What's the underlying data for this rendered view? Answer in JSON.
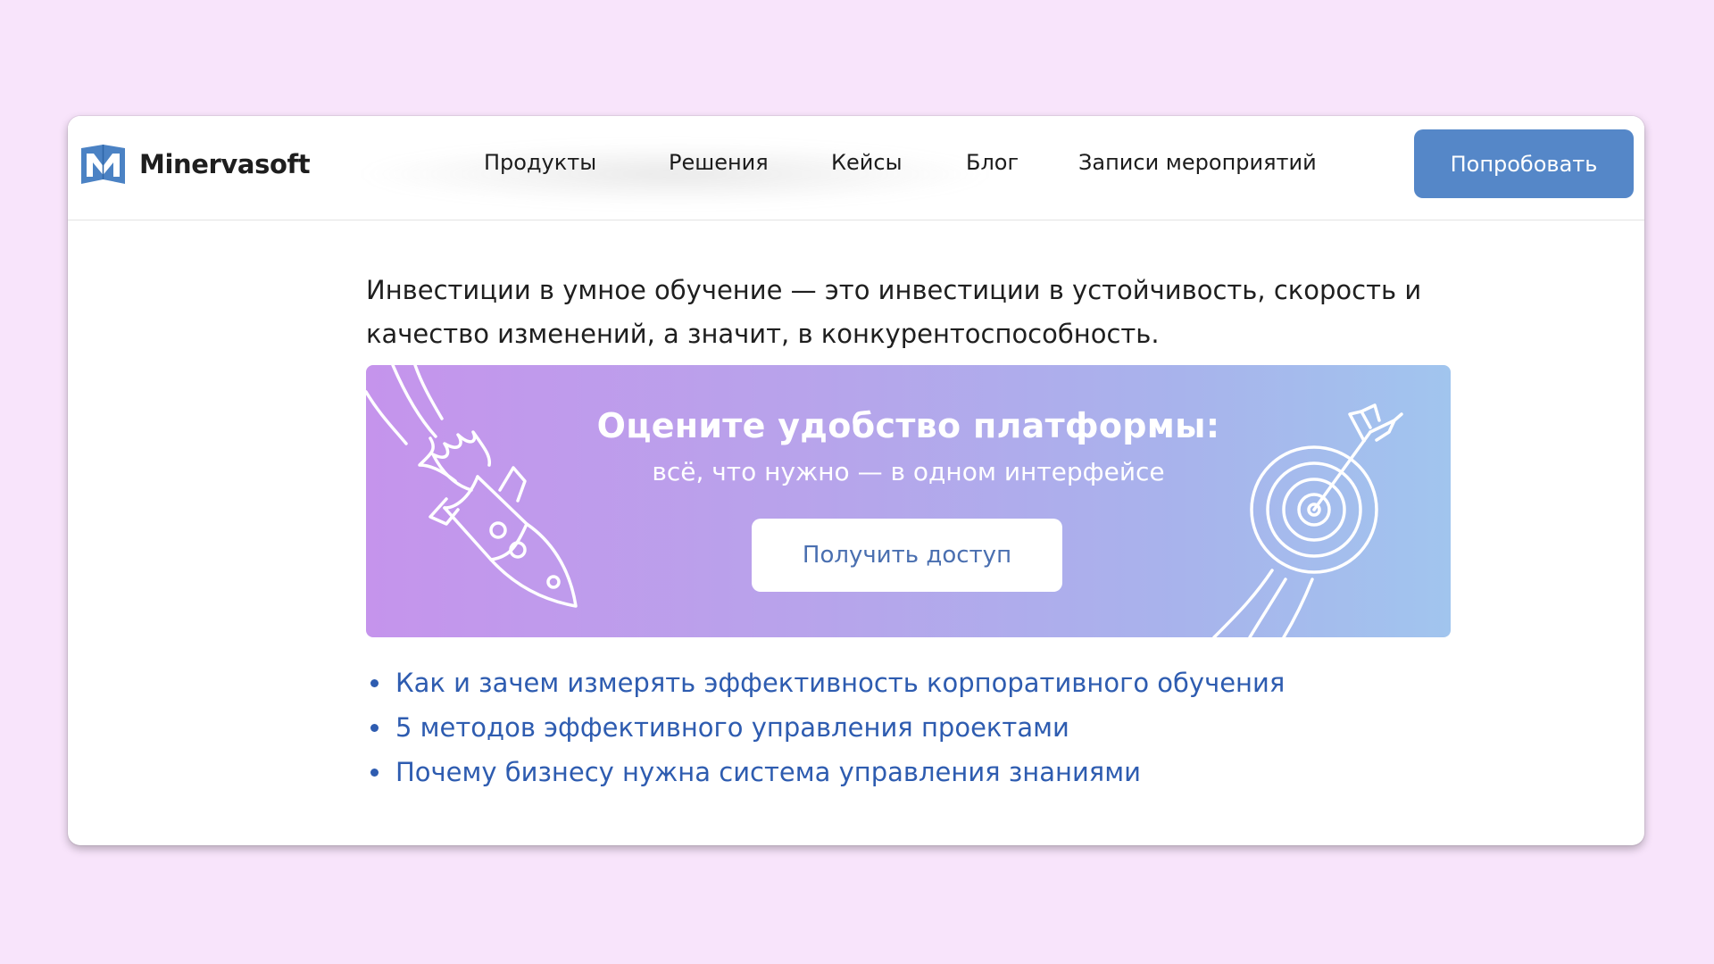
{
  "header": {
    "logo_text": "Minervasoft",
    "logo_icon": "minervasoft-logo-icon",
    "nav": [
      {
        "label": "Продукты"
      },
      {
        "label": "Решения"
      },
      {
        "label": "Кейсы"
      },
      {
        "label": "Блог"
      },
      {
        "label": "Записи мероприятий"
      }
    ],
    "cta_label": "Попробовать",
    "cta_color": "#5587c8"
  },
  "article": {
    "intro": "Инвестиции в умное обучение — это инвестиции в устойчивость, скорость и качество изменений, а значит, в конкурентоспособность."
  },
  "banner": {
    "title": "Оцените удобство платформы:",
    "subtitle": "всё, что нужно — в одном интерфейсе",
    "button_label": "Получить доступ",
    "left_icon": "rocket-icon",
    "right_icon": "target-arrow-icon",
    "gradient_start": "#c594ec",
    "gradient_end": "#a1c5ee"
  },
  "related_links": [
    {
      "label": "Как и зачем измерять эффективность корпоративного обучения"
    },
    {
      "label": "5 методов эффективного управления проектами"
    },
    {
      "label": "Почему бизнесу нужна система управления знаниями"
    }
  ],
  "colors": {
    "page_background": "#f8e4fb",
    "link": "#2e5cb0"
  }
}
